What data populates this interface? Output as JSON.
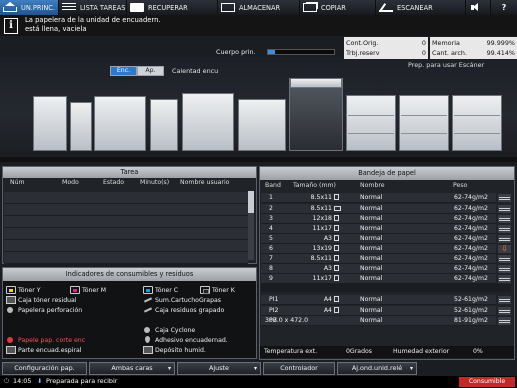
{
  "nav": {
    "tabs": [
      {
        "label": "UN.PRINC.",
        "icon": "home-icon"
      },
      {
        "label": "LISTA TAREAS",
        "icon": "list-icon"
      },
      {
        "label": "RECUPERAR",
        "icon": "recover-icon"
      },
      {
        "label": "ALMACENAR",
        "icon": "store-icon"
      },
      {
        "label": "COPIAR",
        "icon": "copy-icon"
      },
      {
        "label": "ESCANEAR",
        "icon": "scan-icon"
      }
    ],
    "volume_icon": "volume-icon",
    "help_label": "?"
  },
  "message": {
    "icon": "info-icon",
    "icon_glyph": "i",
    "line1": "La papelera de la unidad de encuadern.",
    "line2": "está llena, vaciela"
  },
  "body_print": {
    "label": "Cuerpo prin.",
    "progress": 0.1
  },
  "counters": {
    "orig_label": "Cont.Orig.",
    "orig_value": "0",
    "reserv_label": "Trbj.reserv",
    "reserv_value": "0",
    "memory_label": "Memoria",
    "memory_value": "99.999%",
    "archive_label": "Cant. arch.",
    "archive_value": "99.414%"
  },
  "scan_status": "Prep. para usar Escáner",
  "mode": {
    "on_label": "Enc.",
    "off_label": "Ap."
  },
  "stapler_label": "Calentad encu",
  "tarea": {
    "title": "Tarea",
    "columns": [
      "Núm",
      "Modo",
      "Estado",
      "Minuto(s)",
      "Nombre usuario"
    ],
    "rows": [
      "",
      "",
      "",
      "",
      "",
      ""
    ]
  },
  "consumables": {
    "title": "Indicadores de consumibles y residuos",
    "items": [
      {
        "label": "Tóner Y",
        "icon": "toner-yellow-icon"
      },
      {
        "label": "Tóner M",
        "icon": "toner-magenta-icon"
      },
      {
        "label": "Tóner C",
        "icon": "toner-cyan-icon"
      },
      {
        "label": "Tóner K",
        "icon": "toner-black-icon"
      },
      {
        "label": "Caja tóner residual",
        "icon": "waste-toner-box-icon"
      },
      {
        "label": "Sum.CartuchoGrapas",
        "icon": "staple-cartridge-icon"
      },
      {
        "label": "Papelera perforación",
        "icon": "punch-waste-icon"
      },
      {
        "label": "Caja residuos grapado",
        "icon": "staple-waste-icon"
      },
      {
        "label": "Caja Cyclone",
        "icon": "cyclone-box-icon"
      },
      {
        "label": "Papele pap. corte enc",
        "icon": "trim-waste-icon",
        "warning": true
      },
      {
        "label": "Adhesivo encuadernad.",
        "icon": "adhesive-icon"
      },
      {
        "label": "Parte encuad.espiral",
        "icon": "spiral-binding-icon"
      },
      {
        "label": "Depósito humid.",
        "icon": "humidifier-tank-icon"
      }
    ]
  },
  "bandeja": {
    "title": "Bandeja de papel",
    "columns": [
      "Band",
      "Tamaño (mm)",
      "Nombre",
      "Peso"
    ],
    "trays": [
      {
        "band": "1",
        "size": "8.5x11",
        "orient": "portrait",
        "name": "Normal",
        "weight": "62-74g/m2",
        "level": 0.7
      },
      {
        "band": "2",
        "size": "8.5x11",
        "orient": "landscape",
        "name": "Normal",
        "weight": "62-74g/m2",
        "level": 0.7
      },
      {
        "band": "3",
        "size": "12x18",
        "orient": "portrait",
        "name": "Normal",
        "weight": "62-74g/m2",
        "level": 0.7
      },
      {
        "band": "4",
        "size": "11x17",
        "orient": "portrait",
        "name": "Normal",
        "weight": "62-74g/m2",
        "level": 0.7
      },
      {
        "band": "5",
        "size": "A3",
        "orient": "portrait",
        "name": "Normal",
        "weight": "62-74g/m2",
        "level": 0.7
      },
      {
        "band": "6",
        "size": "13x19",
        "orient": "portrait",
        "name": "Normal",
        "weight": "62-74g/m2",
        "level": 0,
        "empty": true
      },
      {
        "band": "7",
        "size": "8.5x11",
        "orient": "portrait",
        "name": "Normal",
        "weight": "62-74g/m2",
        "level": 0.7
      },
      {
        "band": "8",
        "size": "A3",
        "orient": "portrait",
        "name": "Normal",
        "weight": "62-74g/m2",
        "level": 0.7
      },
      {
        "band": "9",
        "size": "11x17",
        "orient": "portrait",
        "name": "Normal",
        "weight": "62-74g/m2",
        "level": 0.7
      },
      {
        "band": "PI1",
        "size": "A4",
        "orient": "portrait",
        "name": "Normal",
        "weight": "52-61g/m2",
        "level": 0.7
      },
      {
        "band": "PI2",
        "size": "A4",
        "orient": "portrait",
        "name": "Normal",
        "weight": "52-61g/m2",
        "level": 0.7
      },
      {
        "band": "PB",
        "size": "307.0 x 472.0",
        "orient": "",
        "name": "Normal",
        "weight": "81-91g/m2",
        "level": 0.7
      }
    ],
    "temperature_label": "Temperatura ext.",
    "temperature_value": "0Grados",
    "humidity_label": "Humedad exterior",
    "humidity_value": "0%"
  },
  "bottom_buttons": [
    {
      "label": "Configuración pap.",
      "dropdown": false
    },
    {
      "label": "Ambas caras",
      "dropdown": true
    },
    {
      "label": "Ajuste",
      "dropdown": true
    },
    {
      "label": "Controlador",
      "dropdown": false
    },
    {
      "label": "Aj.ond.unid.relé",
      "dropdown": true
    }
  ],
  "status_bar": {
    "time": "14:05",
    "message": "Preparada para recibir",
    "consumables_label": "Consumible"
  },
  "colors": {
    "accent": "#2f79c7",
    "warning": "#ff5252",
    "alert_button": "#c62828"
  }
}
